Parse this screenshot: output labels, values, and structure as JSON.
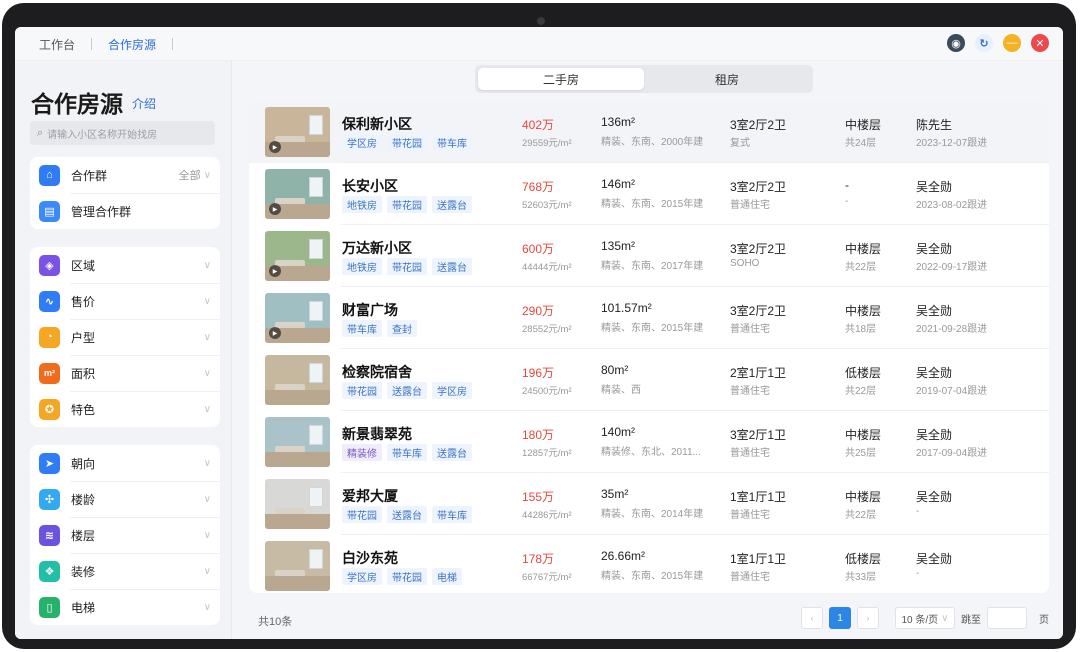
{
  "topbar": {
    "nav": [
      {
        "label": "工作台",
        "active": false
      },
      {
        "label": "合作房源",
        "active": true
      }
    ]
  },
  "sidebar": {
    "title": "合作房源",
    "intro": "介绍",
    "search_placeholder": "请输入小区名称开始找房",
    "group_card": [
      {
        "label": "合作群",
        "right": "全部",
        "icon": "home-icon",
        "color": "#2f7cf6"
      },
      {
        "label": "管理合作群",
        "right": "",
        "icon": "group-manage-icon",
        "color": "#3b8af7"
      }
    ],
    "filter_card_1": [
      {
        "label": "区域",
        "icon": "compass-icon",
        "color": "#7b52e6"
      },
      {
        "label": "售价",
        "icon": "trend-icon",
        "color": "#2f7cf6"
      },
      {
        "label": "户型",
        "icon": "pie-icon",
        "color": "#f5a623"
      },
      {
        "label": "面积",
        "icon": "area-icon",
        "color": "#f26b1d",
        "glyph": "m²"
      },
      {
        "label": "特色",
        "icon": "star-badge-icon",
        "color": "#f5a623"
      }
    ],
    "filter_card_2": [
      {
        "label": "朝向",
        "icon": "direction-icon",
        "color": "#2f7cf6"
      },
      {
        "label": "楼龄",
        "icon": "age-icon",
        "color": "#33a9f2"
      },
      {
        "label": "楼层",
        "icon": "layers-icon",
        "color": "#6c52e0"
      },
      {
        "label": "装修",
        "icon": "decor-icon",
        "color": "#20c0a6"
      },
      {
        "label": "电梯",
        "icon": "elevator-icon",
        "color": "#27b26b"
      }
    ]
  },
  "tabs": [
    "二手房",
    "租房"
  ],
  "listings": [
    {
      "name": "保利新小区",
      "tags": [
        "学区房",
        "带花园",
        "带车库"
      ],
      "price": "402万",
      "unit_price": "29559元/m²",
      "area": "136m²",
      "decoration": "精装、东南、2000年建",
      "layout": "3室2厅2卫",
      "ptype": "复式",
      "floor": "中楼层",
      "total_floors": "共24层",
      "agent": "陈先生",
      "follow": "2023-12-07跟进",
      "wall": "#c9b59a"
    },
    {
      "name": "长安小区",
      "tags": [
        "地铁房",
        "带花园",
        "送露台"
      ],
      "price": "768万",
      "unit_price": "52603元/m²",
      "area": "146m²",
      "decoration": "精装、东南、2015年建",
      "layout": "3室2厅2卫",
      "ptype": "普通住宅",
      "floor": "-",
      "total_floors": "-",
      "agent": "吴全勋",
      "follow": "2023-08-02跟进",
      "wall": "#8fb3a9"
    },
    {
      "name": "万达新小区",
      "tags": [
        "地铁房",
        "带花园",
        "送露台"
      ],
      "price": "600万",
      "unit_price": "44444元/m²",
      "area": "135m²",
      "decoration": "精装、东南、2017年建",
      "layout": "3室2厅2卫",
      "ptype": "SOHO",
      "floor": "中楼层",
      "total_floors": "共22层",
      "agent": "吴全勋",
      "follow": "2022-09-17跟进",
      "wall": "#9db78d"
    },
    {
      "name": "财富广场",
      "tags": [
        "带车库",
        "查封"
      ],
      "price": "290万",
      "unit_price": "28552元/m²",
      "area": "101.57m²",
      "decoration": "精装、东南、2015年建",
      "layout": "3室2厅2卫",
      "ptype": "普通住宅",
      "floor": "中楼层",
      "total_floors": "共18层",
      "agent": "吴全勋",
      "follow": "2021-09-28跟进",
      "wall": "#9fbfc3"
    },
    {
      "name": "检察院宿舍",
      "tags": [
        "带花园",
        "送露台",
        "学区房"
      ],
      "price": "196万",
      "unit_price": "24500元/m²",
      "area": "80m²",
      "decoration": "精装、西",
      "layout": "2室1厅1卫",
      "ptype": "普通住宅",
      "floor": "低楼层",
      "total_floors": "共22层",
      "agent": "吴全勋",
      "follow": "2019-07-04跟进",
      "wall": "#c6b79f"
    },
    {
      "name": "新景翡翠苑",
      "tags": [
        "精装修",
        "带车库",
        "送露台"
      ],
      "price": "180万",
      "unit_price": "12857元/m²",
      "area": "140m²",
      "decoration": "精装修、东北、2011...",
      "layout": "3室2厅1卫",
      "ptype": "普通住宅",
      "floor": "中楼层",
      "total_floors": "共25层",
      "agent": "吴全勋",
      "follow": "2017-09-04跟进",
      "wall": "#a9c3c9"
    },
    {
      "name": "爱邦大厦",
      "tags": [
        "带花园",
        "送露台",
        "带车库"
      ],
      "price": "155万",
      "unit_price": "44286元/m²",
      "area": "35m²",
      "decoration": "精装、东南、2014年建",
      "layout": "1室1厅1卫",
      "ptype": "普通住宅",
      "floor": "中楼层",
      "total_floors": "共22层",
      "agent": "吴全勋",
      "follow": "-",
      "wall": "#d8d8d6"
    },
    {
      "name": "白沙东苑",
      "tags": [
        "学区房",
        "带花园",
        "电梯"
      ],
      "price": "178万",
      "unit_price": "66767元/m²",
      "area": "26.66m²",
      "decoration": "精装、东南、2015年建",
      "layout": "1室1厅1卫",
      "ptype": "普通住宅",
      "floor": "低楼层",
      "total_floors": "共33层",
      "agent": "吴全勋",
      "follow": "-",
      "wall": "#c8bba6"
    }
  ],
  "footer": {
    "total": "共10条",
    "current_page": "1",
    "page_size": "10 条/页",
    "jump_label": "跳至",
    "page_unit": "页"
  }
}
